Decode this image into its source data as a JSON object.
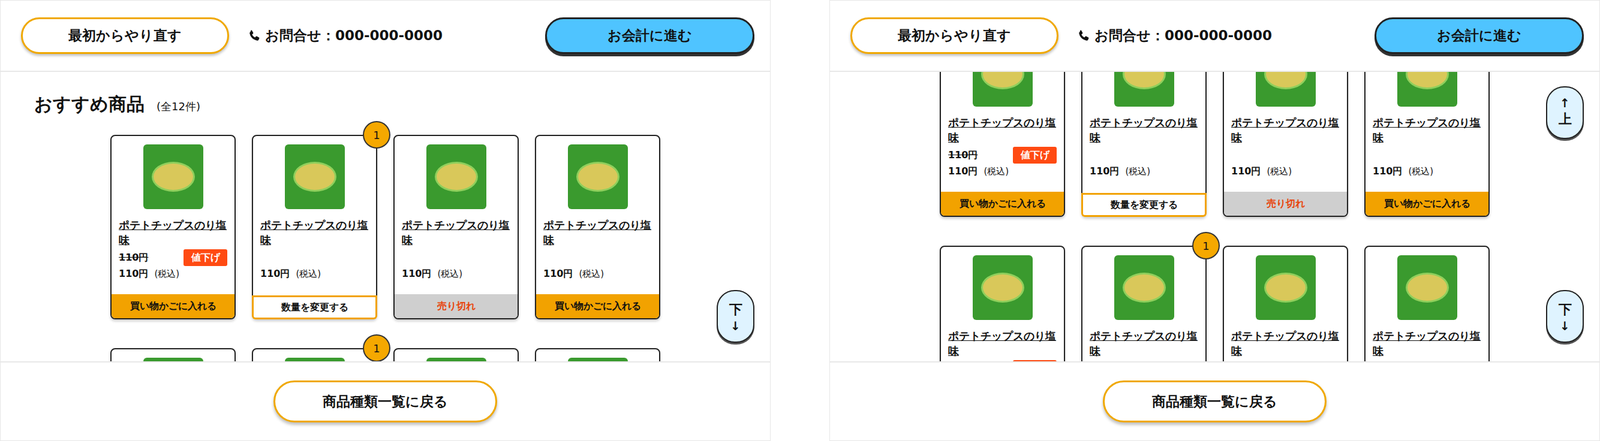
{
  "screens": [
    {
      "scrolled": false,
      "header": {
        "restart": "最初からやり直す",
        "phone": "お問合せ：000-000-0000",
        "checkout": "お会計に進む"
      },
      "title": "おすすめ商品",
      "total": "(全12件)",
      "rows": [
        [
          {
            "name": "ポテトチップスのり塩味",
            "old_price": "110円",
            "sale": true,
            "sale_label": "値下げ",
            "price": "110円",
            "tax": "(税込)",
            "button": {
              "label": "買い物かごに入れる",
              "kind": "add"
            }
          },
          {
            "name": "ポテトチップスのり塩味",
            "sale": false,
            "count": "1",
            "price": "110円",
            "tax": "(税込)",
            "button": {
              "label": "数量を変更する",
              "kind": "change"
            }
          },
          {
            "name": "ポテトチップスのり塩味",
            "sale": false,
            "price": "110円",
            "tax": "(税込)",
            "button": {
              "label": "売り切れ",
              "kind": "soldout"
            }
          },
          {
            "name": "ポテトチップスのり塩味",
            "sale": false,
            "price": "110円",
            "tax": "(税込)",
            "button": {
              "label": "買い物かごに入れる",
              "kind": "add"
            }
          }
        ],
        [
          {
            "sale": false
          },
          {
            "sale": false,
            "count": "1"
          },
          {
            "sale": false
          },
          {
            "sale": false
          }
        ]
      ],
      "scroll_buttons": [
        {
          "kind": "down",
          "label": "下",
          "arrow": "↓"
        }
      ],
      "footer_button": "商品種類一覧に戻る"
    },
    {
      "scrolled": true,
      "header": {
        "restart": "最初からやり直す",
        "phone": "お問合せ：000-000-0000",
        "checkout": "お会計に進む"
      },
      "rows": [
        [
          {
            "name": "ポテトチップスのり塩味",
            "old_price": "110円",
            "sale": true,
            "sale_label": "値下げ",
            "price": "110円",
            "tax": "(税込)",
            "button": {
              "label": "買い物かごに入れる",
              "kind": "add"
            }
          },
          {
            "name": "ポテトチップスのり塩味",
            "sale": false,
            "price": "110円",
            "tax": "(税込)",
            "button": {
              "label": "数量を変更する",
              "kind": "change"
            }
          },
          {
            "name": "ポテトチップスのり塩味",
            "sale": false,
            "price": "110円",
            "tax": "(税込)",
            "button": {
              "label": "売り切れ",
              "kind": "soldout"
            }
          },
          {
            "name": "ポテトチップスのり塩味",
            "sale": false,
            "price": "110円",
            "tax": "(税込)",
            "button": {
              "label": "買い物かごに入れる",
              "kind": "add"
            }
          }
        ],
        [
          {
            "name": "ポテトチップスのり塩味",
            "sale": true
          },
          {
            "name": "ポテトチップスのり塩味",
            "sale": false,
            "count": "1"
          },
          {
            "name": "ポテトチップスのり塩味",
            "sale": false
          },
          {
            "name": "ポテトチップスのり塩味",
            "sale": false
          }
        ]
      ],
      "scroll_buttons": [
        {
          "kind": "up",
          "label": "上",
          "arrow": "↑"
        },
        {
          "kind": "down",
          "label": "下",
          "arrow": "↓"
        }
      ],
      "footer_button": "商品種類一覧に戻る"
    }
  ]
}
